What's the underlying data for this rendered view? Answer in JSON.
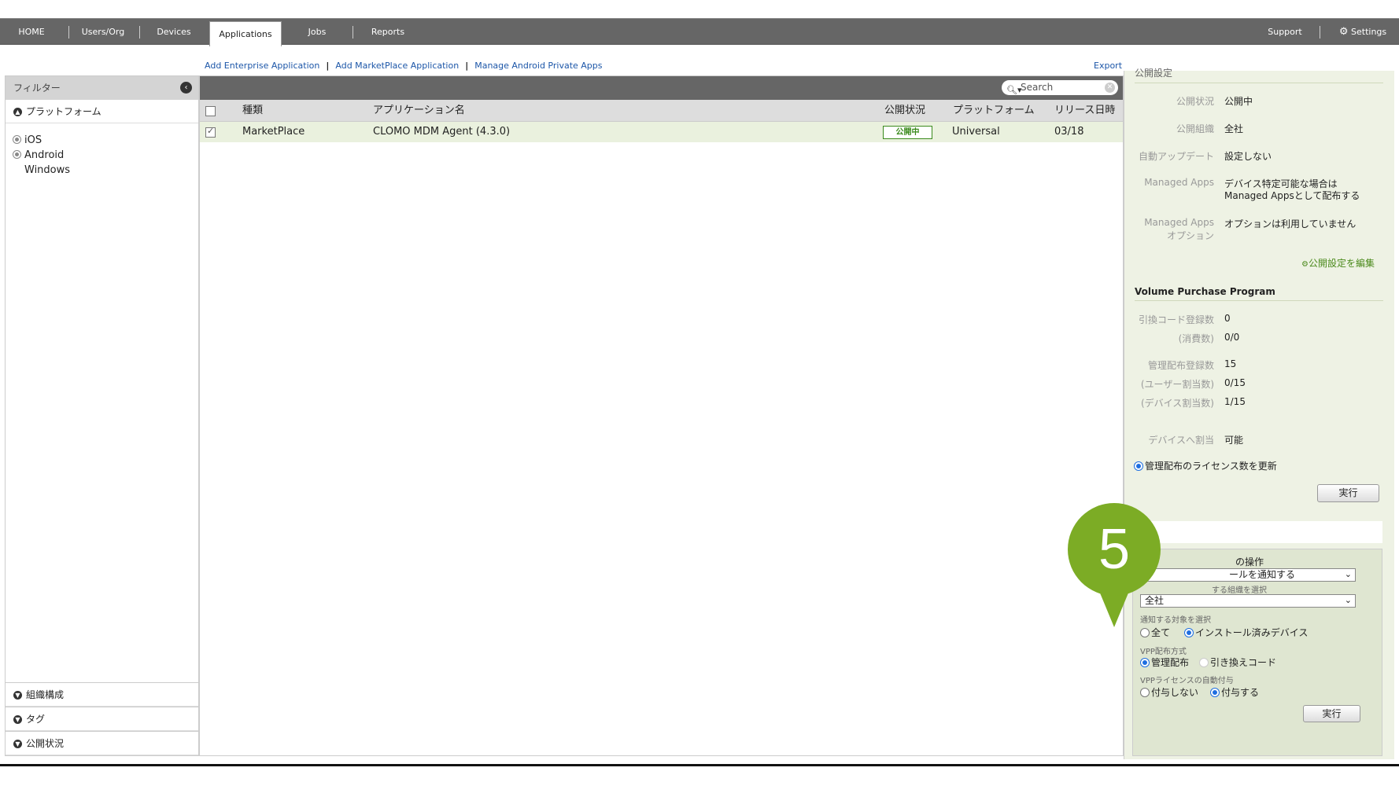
{
  "nav": {
    "items": [
      "HOME",
      "Users/Org",
      "Devices",
      "Applications",
      "Jobs",
      "Reports"
    ],
    "support": "Support",
    "settings": "Settings"
  },
  "sublinks": {
    "add_enterprise": "Add Enterprise Application",
    "add_marketplace": "Add MarketPlace Application",
    "manage_android": "Manage Android Private Apps",
    "export": "Export"
  },
  "sidebar": {
    "filter_title": "フィルター",
    "platform_title": "プラットフォーム",
    "platforms": [
      "iOS",
      "Android",
      "Windows"
    ],
    "sections": [
      "組織構成",
      "タグ",
      "公開状況"
    ]
  },
  "search": {
    "placeholder": "Search"
  },
  "table": {
    "headers": [
      "種類",
      "アプリケーション名",
      "公開状況",
      "プラットフォーム",
      "リリース日時"
    ],
    "rows": [
      {
        "type": "MarketPlace",
        "name": "CLOMO MDM Agent (4.3.0)",
        "status": "公開中",
        "platform": "Universal",
        "release": "03/18"
      }
    ]
  },
  "right": {
    "pub_header": "公開設定",
    "pub": [
      {
        "label": "公開状況",
        "value": "公開中"
      },
      {
        "label": "公開組織",
        "value": "全社"
      },
      {
        "label": "自動アップデート",
        "value": "設定しない"
      },
      {
        "label": "Managed Apps",
        "value": "デバイス特定可能な場合は",
        "value2": "Managed Appsとして配布する"
      },
      {
        "label": "Managed Apps",
        "label2": "オプション",
        "value": "オプションは利用していません"
      }
    ],
    "edit_link": "公開設定を編集",
    "vpp_header": "Volume Purchase Program",
    "vpp": [
      {
        "label": "引換コード登録数",
        "value": "0"
      },
      {
        "label": "(消費数)",
        "value": "0/0"
      },
      {
        "label": "管理配布登録数",
        "value": "15"
      },
      {
        "label": "(ユーザー割当数)",
        "value": "0/15"
      },
      {
        "label": "(デバイス割当数)",
        "value": "1/15"
      },
      {
        "label": "デバイスへ割当",
        "value": "可能"
      }
    ],
    "license_update": "管理配布のライセンス数を更新",
    "run": "実行",
    "op": {
      "title_partial": "の操作",
      "select1_partial": "ールを通知する",
      "label2_partial": "する組織を選択",
      "select2": "全社",
      "label3": "通知する対象を選択",
      "target_all": "全て",
      "target_installed": "インストール済みデバイス",
      "vpp_method": "VPP配布方式",
      "method_managed": "管理配布",
      "method_code": "引き換えコード",
      "auto_assign": "VPPライセンスの自動付与",
      "assign_no": "付与しない",
      "assign_yes": "付与する",
      "run": "実行"
    }
  },
  "marker": "5",
  "colors": {
    "nav_bg": "#666666",
    "link": "#1c56a8",
    "panel_bg": "#eef2e4",
    "marker": "#7cac25",
    "status": "#3a8a1c"
  }
}
